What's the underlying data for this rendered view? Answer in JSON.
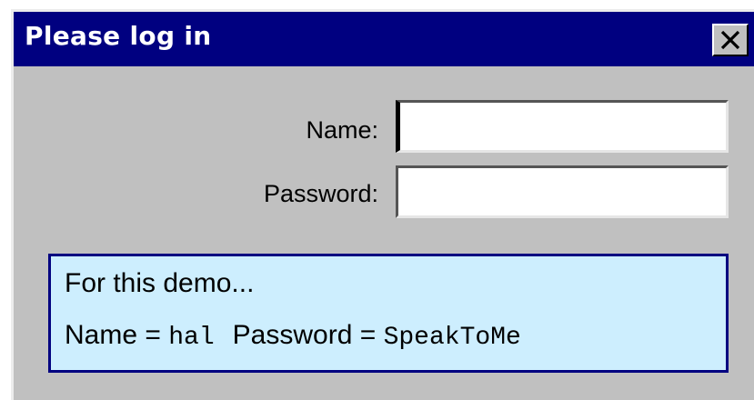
{
  "dialog": {
    "title": "Please log in",
    "close_icon": "close-icon"
  },
  "form": {
    "name_label": "Name:",
    "name_value": "",
    "password_label": "Password:",
    "password_value": ""
  },
  "hint": {
    "line1": "For this demo...",
    "name_prefix": "Name =",
    "name_value": "hal",
    "password_prefix": "Password =",
    "password_value": "SpeakToMe"
  },
  "colors": {
    "titlebar": "#000080",
    "window_bg": "#c0c0c0",
    "hint_bg": "#cdeefe",
    "hint_border": "#000080"
  }
}
